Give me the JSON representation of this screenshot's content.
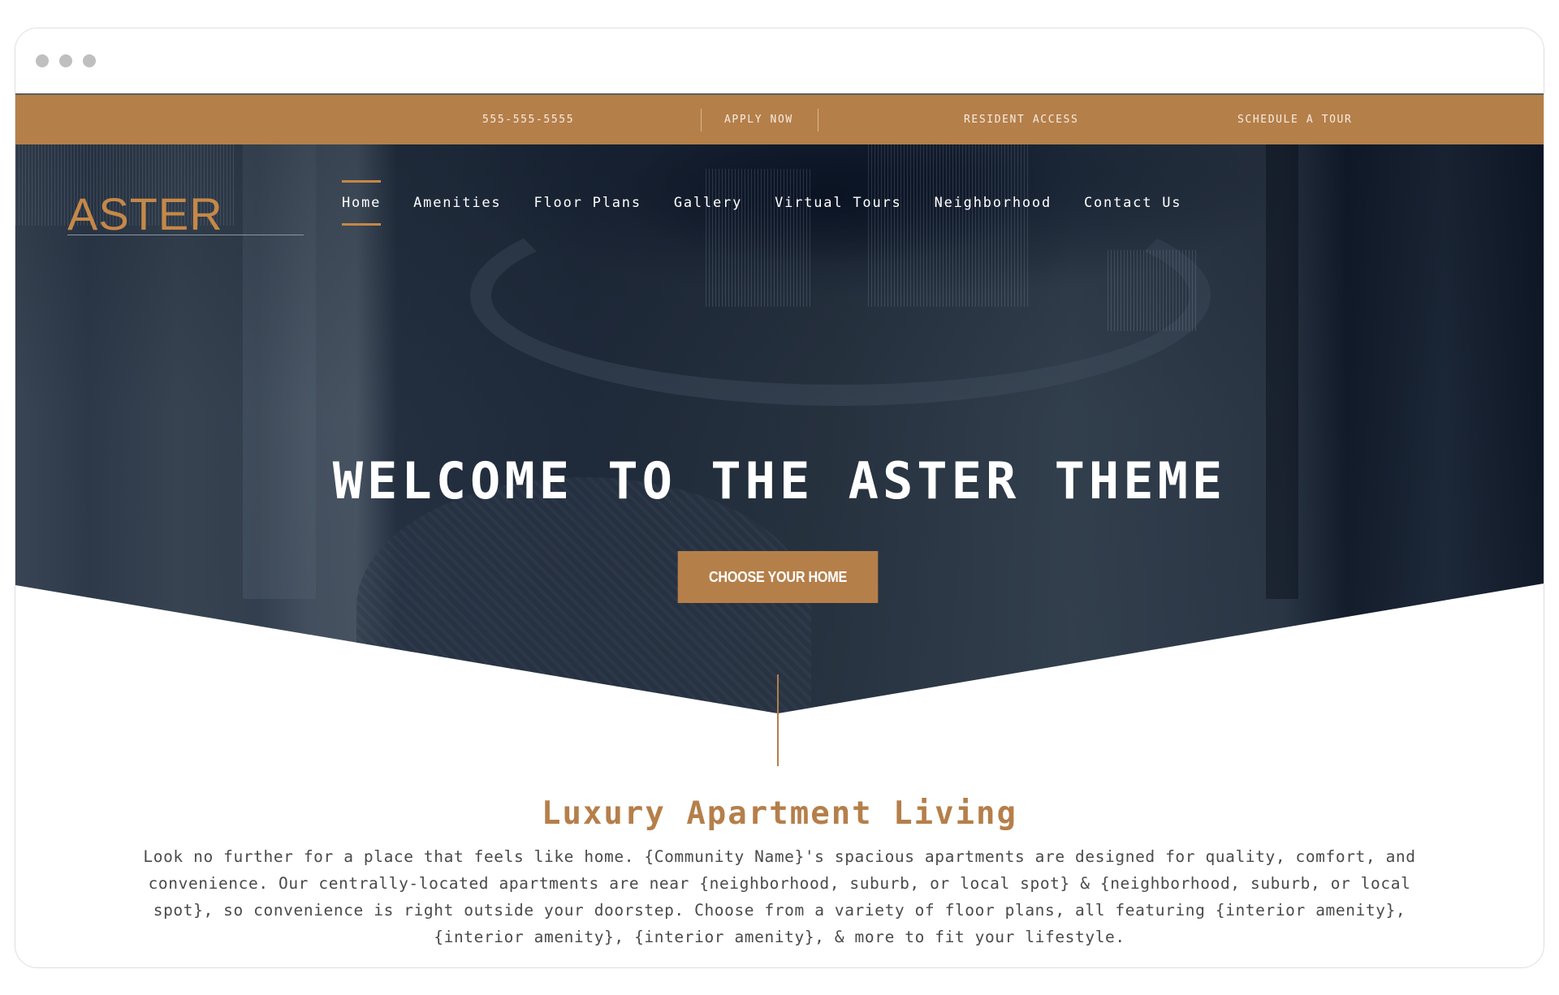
{
  "window": {
    "controls": [
      "close",
      "minimize",
      "maximize"
    ]
  },
  "topbar": {
    "phone": "555-555-5555",
    "apply": "APPLY NOW",
    "resident": "RESIDENT ACCESS",
    "tour": "SCHEDULE A TOUR"
  },
  "brand": {
    "logo": "ASTER",
    "accent_color": "#b57f4a"
  },
  "nav": {
    "items": [
      {
        "label": "Home",
        "active": true
      },
      {
        "label": "Amenities"
      },
      {
        "label": "Floor Plans"
      },
      {
        "label": "Gallery"
      },
      {
        "label": "Virtual Tours"
      },
      {
        "label": "Neighborhood"
      },
      {
        "label": "Contact Us"
      }
    ]
  },
  "hero": {
    "title": "WELCOME TO THE ASTER THEME",
    "cta": "CHOOSE YOUR HOME"
  },
  "intro": {
    "title": "Luxury Apartment Living",
    "body": "Look no further for a place that feels like home. {Community Name}'s spacious apartments are designed for quality, comfort, and convenience. Our centrally-located apartments are near {neighborhood, suburb, or local spot} & {neighborhood, suburb, or local spot}, so convenience is right outside your doorstep. Choose from a variety of floor plans, all featuring {interior amenity}, {interior amenity}, {interior amenity}, & more to fit your lifestyle."
  }
}
